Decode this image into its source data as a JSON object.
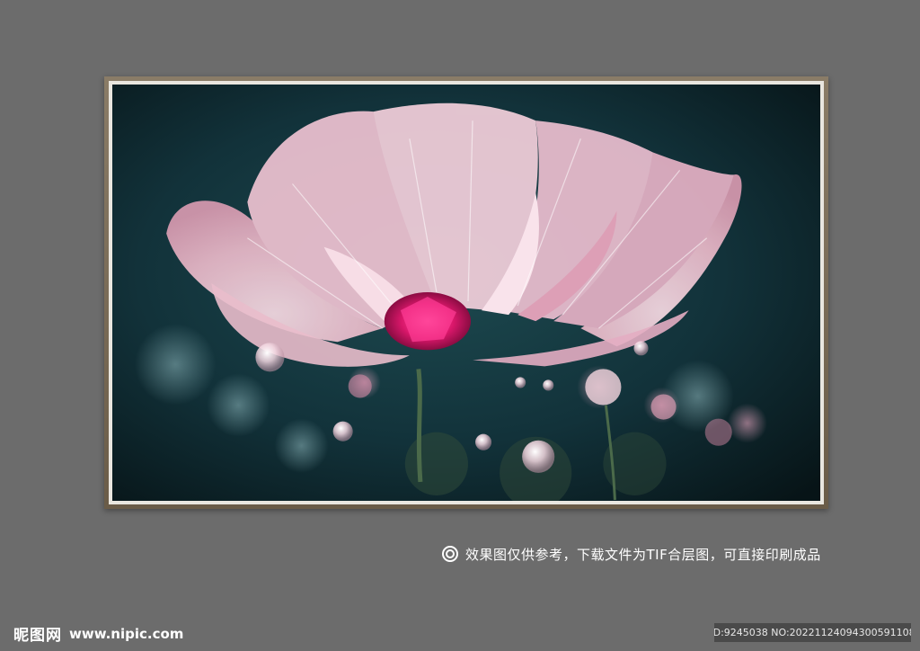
{
  "artwork": {
    "subject": "crystal pink flower with water droplets"
  },
  "caption": {
    "text": "效果图仅供参考，下载文件为TIF合层图，可直接印刷成品"
  },
  "brand": {
    "name": "昵图网",
    "url": "www.nipic.com"
  },
  "watermark": {
    "id_text": "ID:9245038 NO:20221124094300591108"
  },
  "colors": {
    "background": "#6c6c6c",
    "petal": "#f2c9d6",
    "center": "#d9176a",
    "art_background": "#0f2a30"
  }
}
